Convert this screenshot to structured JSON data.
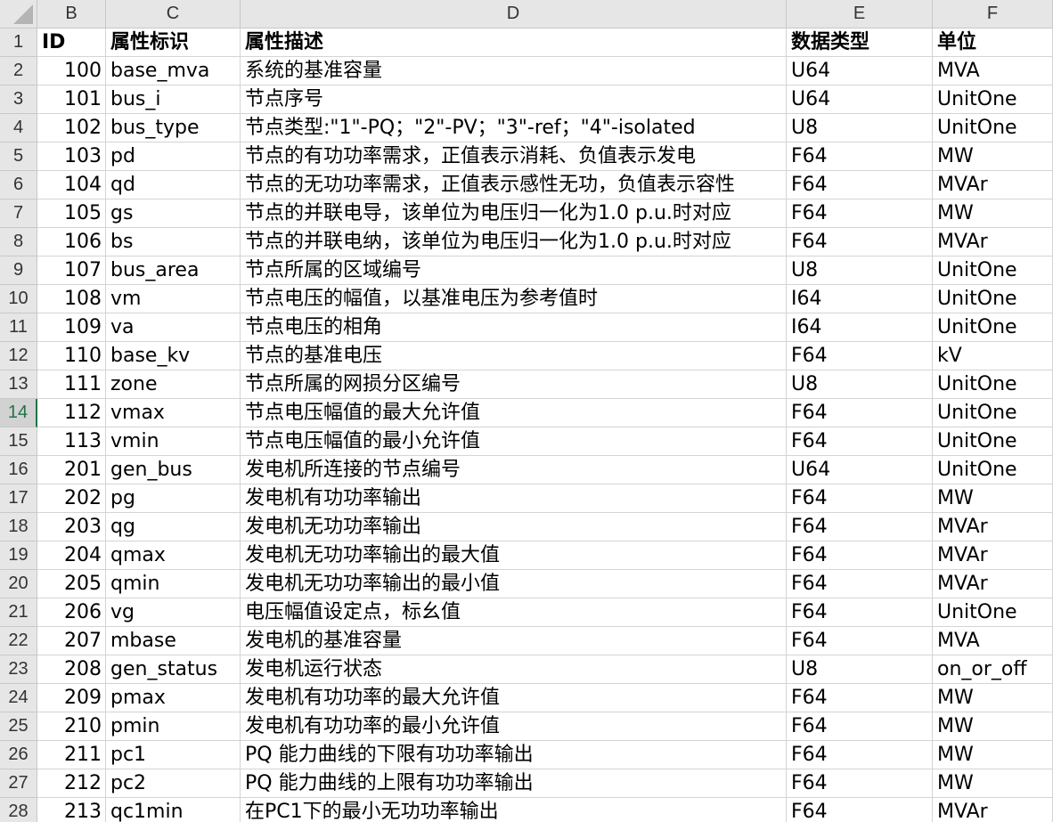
{
  "columns": [
    "B",
    "C",
    "D",
    "E",
    "F"
  ],
  "header": {
    "row": "1",
    "cells": [
      "ID",
      "属性标识",
      "属性描述",
      "数据类型",
      "单位"
    ]
  },
  "active_row": "14",
  "rows": [
    {
      "row": "2",
      "cells": [
        "100",
        "base_mva",
        "系统的基准容量",
        "U64",
        "MVA"
      ]
    },
    {
      "row": "3",
      "cells": [
        "101",
        "bus_i",
        "节点序号",
        "U64",
        "UnitOne"
      ]
    },
    {
      "row": "4",
      "cells": [
        "102",
        "bus_type",
        "节点类型:\"1\"-PQ；\"2\"-PV；\"3\"-ref；\"4\"-isolated",
        "U8",
        "UnitOne"
      ]
    },
    {
      "row": "5",
      "cells": [
        "103",
        "pd",
        "节点的有功功率需求，正值表示消耗、负值表示发电",
        "F64",
        "MW"
      ]
    },
    {
      "row": "6",
      "cells": [
        "104",
        "qd",
        "节点的无功功率需求，正值表示感性无功，负值表示容性",
        "F64",
        "MVAr"
      ]
    },
    {
      "row": "7",
      "cells": [
        "105",
        "gs",
        "节点的并联电导，该单位为电压归一化为1.0 p.u.时对应",
        "F64",
        "MW"
      ]
    },
    {
      "row": "8",
      "cells": [
        "106",
        "bs",
        "节点的并联电纳，该单位为电压归一化为1.0 p.u.时对应",
        "F64",
        "MVAr"
      ]
    },
    {
      "row": "9",
      "cells": [
        "107",
        "bus_area",
        "节点所属的区域编号",
        "U8",
        "UnitOne"
      ]
    },
    {
      "row": "10",
      "cells": [
        "108",
        "vm",
        "节点电压的幅值，以基准电压为参考值时",
        "I64",
        "UnitOne"
      ]
    },
    {
      "row": "11",
      "cells": [
        "109",
        "va",
        "节点电压的相角",
        "I64",
        "UnitOne"
      ]
    },
    {
      "row": "12",
      "cells": [
        "110",
        "base_kv",
        "节点的基准电压",
        "F64",
        "kV"
      ]
    },
    {
      "row": "13",
      "cells": [
        "111",
        "zone",
        "节点所属的网损分区编号",
        "U8",
        "UnitOne"
      ]
    },
    {
      "row": "14",
      "cells": [
        "112",
        "vmax",
        "节点电压幅值的最大允许值",
        "F64",
        "UnitOne"
      ]
    },
    {
      "row": "15",
      "cells": [
        "113",
        "vmin",
        "节点电压幅值的最小允许值",
        "F64",
        "UnitOne"
      ]
    },
    {
      "row": "16",
      "cells": [
        "201",
        "gen_bus",
        "发电机所连接的节点编号",
        "U64",
        "UnitOne"
      ]
    },
    {
      "row": "17",
      "cells": [
        "202",
        "pg",
        "发电机有功功率输出",
        "F64",
        "MW"
      ]
    },
    {
      "row": "18",
      "cells": [
        "203",
        "qg",
        "发电机无功功率输出",
        "F64",
        "MVAr"
      ]
    },
    {
      "row": "19",
      "cells": [
        "204",
        "qmax",
        "发电机无功功率输出的最大值",
        "F64",
        "MVAr"
      ]
    },
    {
      "row": "20",
      "cells": [
        "205",
        "qmin",
        "发电机无功功率输出的最小值",
        "F64",
        "MVAr"
      ]
    },
    {
      "row": "21",
      "cells": [
        "206",
        "vg",
        "电压幅值设定点，标幺值",
        "F64",
        "UnitOne"
      ]
    },
    {
      "row": "22",
      "cells": [
        "207",
        "mbase",
        "发电机的基准容量",
        "F64",
        "MVA"
      ]
    },
    {
      "row": "23",
      "cells": [
        "208",
        "gen_status",
        "发电机运行状态",
        "U8",
        "on_or_off"
      ]
    },
    {
      "row": "24",
      "cells": [
        "209",
        "pmax",
        "发电机有功功率的最大允许值",
        "F64",
        "MW"
      ]
    },
    {
      "row": "25",
      "cells": [
        "210",
        "pmin",
        "发电机有功功率的最小允许值",
        "F64",
        "MW"
      ]
    },
    {
      "row": "26",
      "cells": [
        "211",
        "pc1",
        "PQ 能力曲线的下限有功功率输出",
        "F64",
        "MW"
      ]
    },
    {
      "row": "27",
      "cells": [
        "212",
        "pc2",
        "PQ 能力曲线的上限有功功率输出",
        "F64",
        "MW"
      ]
    },
    {
      "row": "28",
      "cells": [
        "213",
        "qc1min",
        "在PC1下的最小无功功率输出",
        "F64",
        "MVAr"
      ]
    }
  ]
}
